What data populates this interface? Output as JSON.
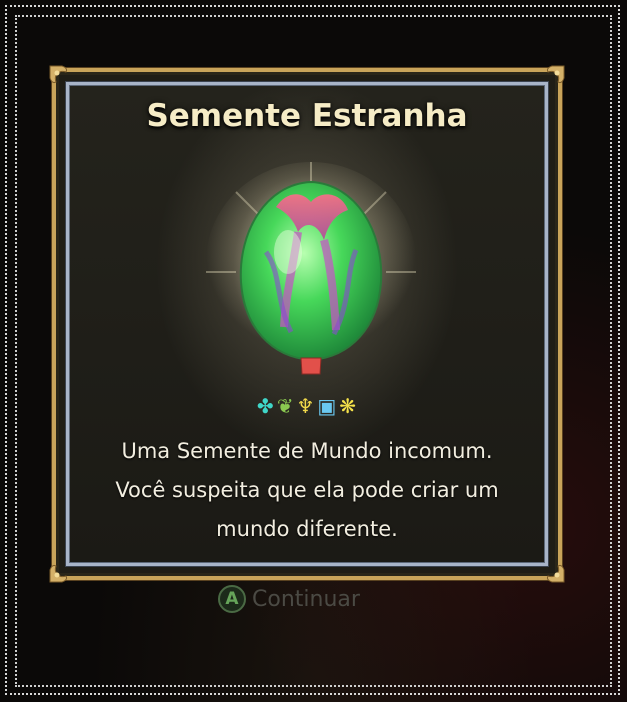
{
  "dialog": {
    "title": "Semente Estranha",
    "item_icon": "strange-seed-icon",
    "glyphs": [
      "teal-swirl-glyph",
      "green-leaf-glyph",
      "yellow-hook-glyph",
      "blue-square-glyph",
      "yellow-flower-glyph"
    ],
    "description_lines": [
      "Uma Semente de Mundo incomum.",
      "Você suspeita que ela pode criar um",
      "mundo diferente."
    ]
  },
  "prompt": {
    "button": "A",
    "label": "Continuar"
  },
  "colors": {
    "title": "#f6ecc6",
    "frame_gold": "#c9a45a",
    "frame_silver": "#a8b4c8",
    "seed_green": "#3fd65a",
    "seed_pink": "#ff5a7a"
  }
}
